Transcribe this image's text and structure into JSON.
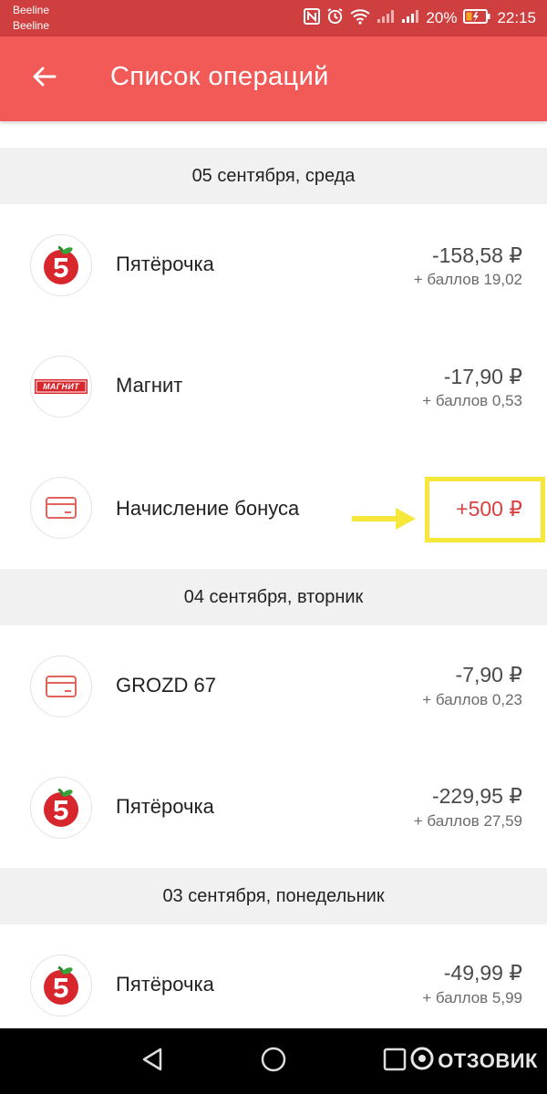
{
  "status_bar": {
    "carrier_1": "Beeline",
    "carrier_2": "Beeline",
    "battery": "20%",
    "time": "22:15"
  },
  "app_bar": {
    "title": "Список операций",
    "back_icon": "arrow-left-icon",
    "color": "#f25a58"
  },
  "sections": [
    {
      "date": "05 сентября, среда",
      "items": [
        {
          "name": "Пятёрочка",
          "amount": "-158,58 ₽",
          "bonus": "+ баллов 19,02",
          "icon": "pyaterochka-logo"
        },
        {
          "name": "Магнит",
          "amount": "-17,90 ₽",
          "bonus": "+ баллов 0,53",
          "icon": "magnit-logo",
          "logo_text": "МАГНИТ"
        },
        {
          "name": "Начисление бонуса",
          "amount": "+500 ₽",
          "bonus": "",
          "icon": "card-icon"
        }
      ]
    },
    {
      "date": "04 сентября, вторник",
      "items": [
        {
          "name": "GROZD 67",
          "amount": "-7,90 ₽",
          "bonus": "+ баллов 0,23",
          "icon": "card-icon"
        },
        {
          "name": "Пятёрочка",
          "amount": "-229,95 ₽",
          "bonus": "+ баллов 27,59",
          "icon": "pyaterochka-logo"
        }
      ]
    },
    {
      "date": "03 сентября, понедельник",
      "items": [
        {
          "name": "Пятёрочка",
          "amount": "-49,99 ₽",
          "bonus": "+ баллов 5,99",
          "icon": "pyaterochka-logo"
        }
      ]
    }
  ],
  "watermark": "ОТЗОВИК",
  "colors": {
    "status_bar": "#cf3f3f",
    "accent": "#f25a58",
    "positive_amount": "#d94141",
    "highlight": "#f5e83a"
  }
}
